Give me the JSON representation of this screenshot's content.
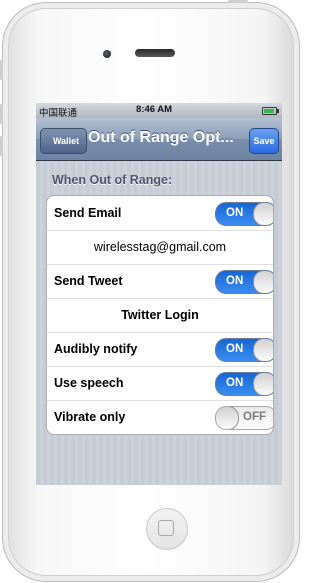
{
  "status_bar": {
    "carrier": "中国联通",
    "time": "8:46 AM"
  },
  "nav": {
    "back_label": "Wallet",
    "title": "Out of Range Opt...",
    "save_label": "Save"
  },
  "section_header": "When Out of Range:",
  "rows": [
    {
      "label": "Send Email",
      "toggle": "ON",
      "is_on": true
    },
    {
      "value": "wirelesstag@gmail.com"
    },
    {
      "label": "Send Tweet",
      "toggle": "ON",
      "is_on": true
    },
    {
      "value": "Twitter Login"
    },
    {
      "label": "Audibly notify",
      "toggle": "ON",
      "is_on": true
    },
    {
      "label": "Use speech",
      "toggle": "ON",
      "is_on": true
    },
    {
      "label": "Vibrate only",
      "toggle": "OFF",
      "is_on": false
    }
  ],
  "colors": {
    "nav_blue": "#7a8fac",
    "toggle_on": "#1667d6",
    "save_blue": "#2a6be0"
  }
}
